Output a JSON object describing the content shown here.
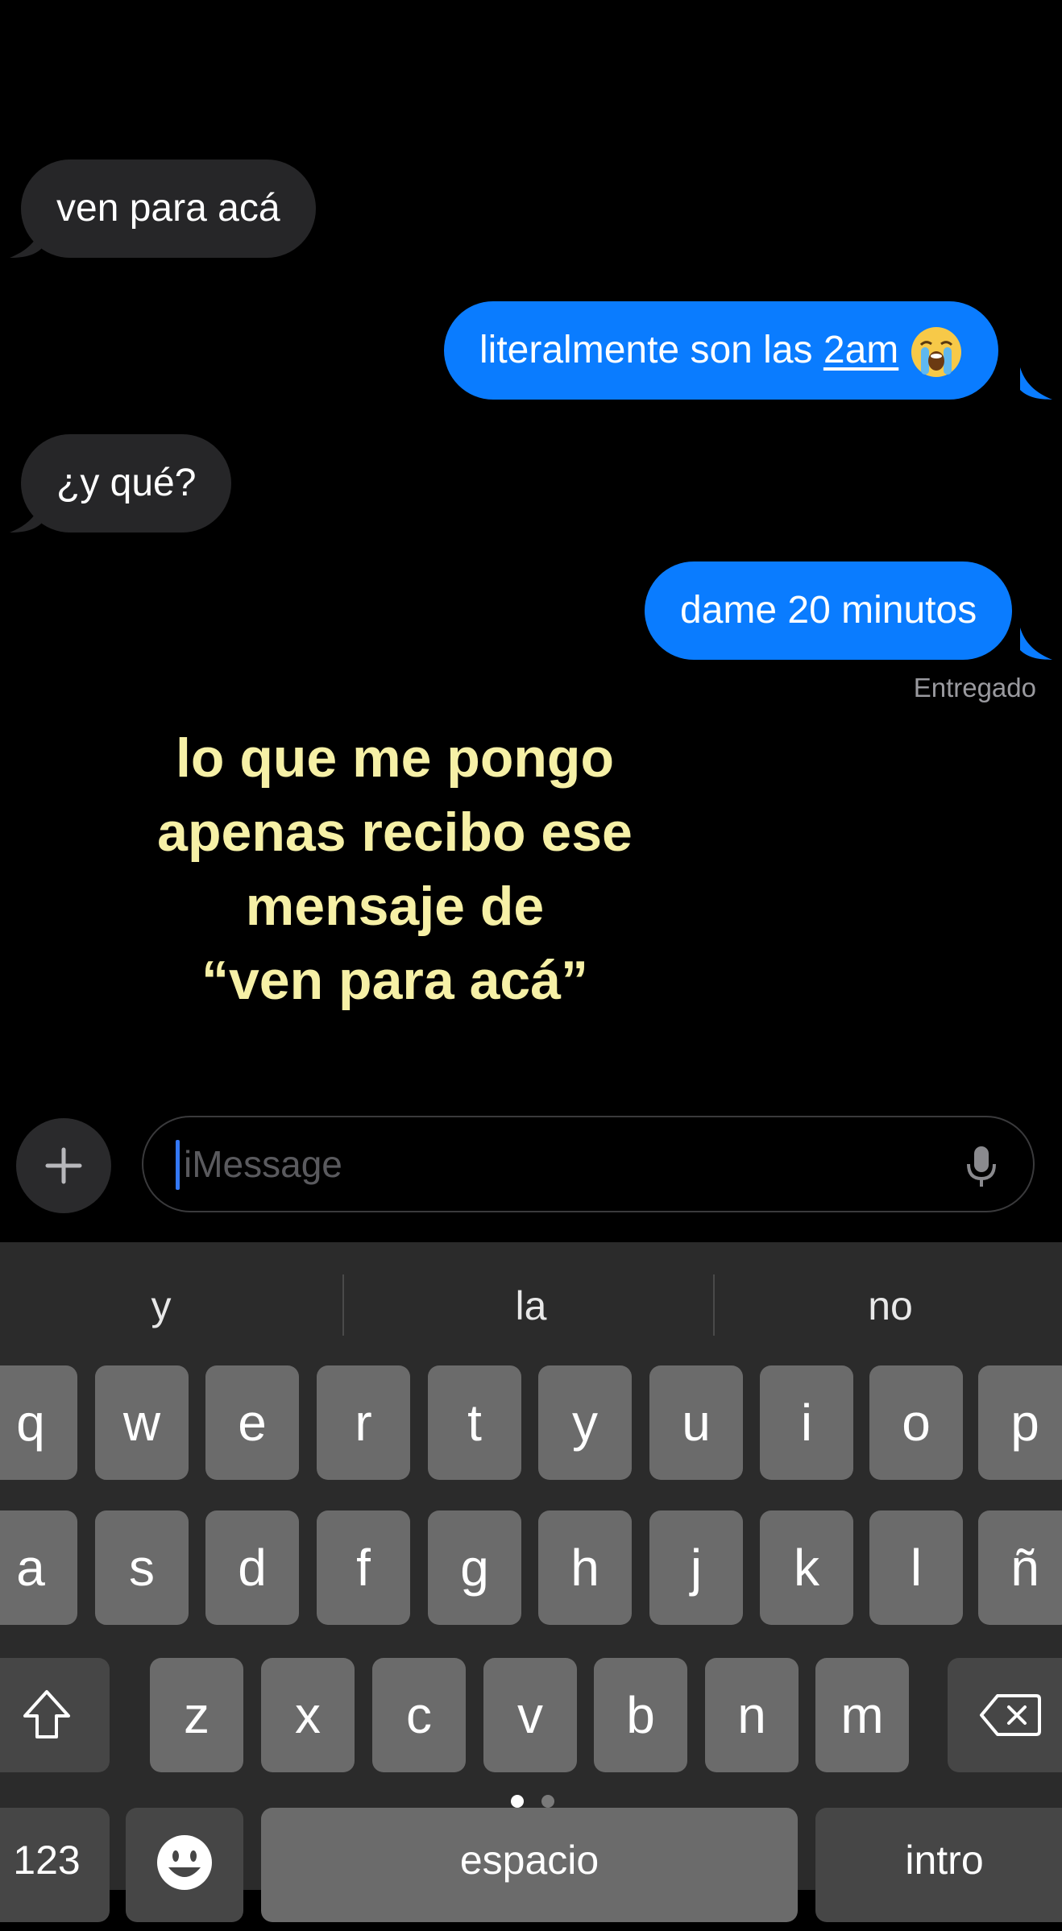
{
  "messages": [
    {
      "from": "them",
      "text": "ven para acá"
    },
    {
      "from": "me",
      "text": "literalmente son las ",
      "link": "2am",
      "emoji": "loudly-crying-face"
    },
    {
      "from": "them",
      "text": "¿y qué?"
    },
    {
      "from": "me",
      "text": "dame 20 minutos"
    }
  ],
  "status": "Entregado",
  "overlay_lines": [
    "lo que me pongo",
    "apenas recibo ese",
    "mensaje de",
    "“ven para acá”"
  ],
  "compose": {
    "placeholder": "iMessage"
  },
  "suggestions": [
    "y",
    "la",
    "no"
  ],
  "keyboard": {
    "row1": [
      "q",
      "w",
      "e",
      "r",
      "t",
      "y",
      "u",
      "i",
      "o",
      "p"
    ],
    "row2": [
      "a",
      "s",
      "d",
      "f",
      "g",
      "h",
      "j",
      "k",
      "l",
      "ñ"
    ],
    "row3": [
      "z",
      "x",
      "c",
      "v",
      "b",
      "n",
      "m"
    ],
    "numbers_label": "123",
    "space_label": "espacio",
    "return_label": "intro",
    "page_count": 2,
    "active_page": 1
  },
  "colors": {
    "sent": "#0a7cff",
    "received": "#262628",
    "overlay_text": "#f6f0a6",
    "background": "#000000"
  }
}
